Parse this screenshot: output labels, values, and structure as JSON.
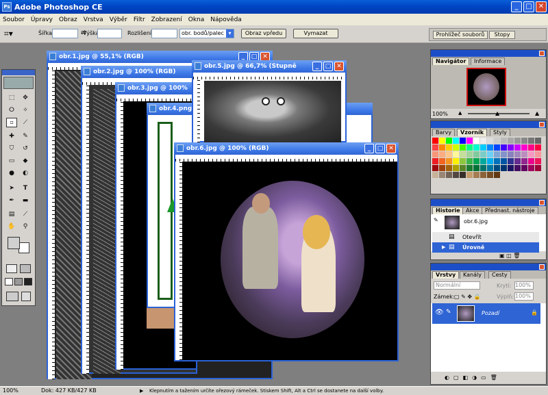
{
  "app": {
    "title": "Adobe Photoshop CE",
    "icon": "photoshop-app-icon",
    "minimize": "_",
    "maximize": "□",
    "close": "✕"
  },
  "menu": [
    "Soubor",
    "Úpravy",
    "Obraz",
    "Vrstva",
    "Výběr",
    "Filtr",
    "Zobrazení",
    "Okna",
    "Nápověda"
  ],
  "options": {
    "width_label": "Šířka:",
    "width_value": "",
    "height_label": "Výška:",
    "height_value": "",
    "resolution_label": "Rozlišení:",
    "resolution_value": "",
    "unit_select": "obr. bodů/palec",
    "front_image_button": "Obraz vpředu",
    "clear_button": "Vymazat",
    "file_browser_tab": "Prohlížeč souborů",
    "brushes_tab": "Stopy"
  },
  "documents": [
    {
      "title": "obr.1.jpg @ 55,1% (RGB)"
    },
    {
      "title": "obr.2.jpg @ 100% (RGB)"
    },
    {
      "title": "obr.3.jpg @ 100%"
    },
    {
      "title": "obr.4.png"
    },
    {
      "title": "obr.5.jpg @ 66,7% (Stupně"
    },
    {
      "title": "obr.6.jpg @ 100% (RGB)"
    }
  ],
  "navigator": {
    "tabs": [
      "Navigátor",
      "Informace"
    ],
    "zoom": "100%"
  },
  "swatches_panel": {
    "tabs": [
      "Barvy",
      "Vzorník",
      "Styly"
    ]
  },
  "swatch_colors": [
    "#ff0000",
    "#ffff00",
    "#00ff00",
    "#00ffff",
    "#0000ff",
    "#ff00ff",
    "#ffffff",
    "#eeeeee",
    "#dddddd",
    "#cccccc",
    "#bbbbbb",
    "#aaaaaa",
    "#999999",
    "#888888",
    "#777777",
    "#666666",
    "#ff4444",
    "#ff8800",
    "#ffcc00",
    "#ccff00",
    "#44ff00",
    "#00ff88",
    "#00ffcc",
    "#00ccff",
    "#0088ff",
    "#0044ff",
    "#4400ff",
    "#8800ff",
    "#cc00ff",
    "#ff00cc",
    "#ff0088",
    "#ff0044",
    "#f7977a",
    "#f9ad81",
    "#fdc68a",
    "#fff79a",
    "#c4df9b",
    "#a2d39c",
    "#82ca9d",
    "#7bcdc8",
    "#6ecff6",
    "#7ea7d8",
    "#8493ca",
    "#8882be",
    "#a187be",
    "#bc8dbf",
    "#f49ac2",
    "#f6989d",
    "#ed1c24",
    "#f26522",
    "#f7941d",
    "#fff200",
    "#8dc73f",
    "#39b54a",
    "#00a651",
    "#00a99d",
    "#00aeef",
    "#0072bc",
    "#0054a6",
    "#2e3192",
    "#662d91",
    "#92278f",
    "#ec008c",
    "#ed145b",
    "#9e0b0f",
    "#a0410d",
    "#a3620a",
    "#aba000",
    "#598527",
    "#1a7b30",
    "#007236",
    "#00746b",
    "#0076a3",
    "#004b80",
    "#003471",
    "#1b1464",
    "#440e62",
    "#630460",
    "#9e005d",
    "#9e0039",
    "#c7b299",
    "#998675",
    "#736357",
    "#534741",
    "#37302a",
    "#c69c6d",
    "#a67c52",
    "#8c6239",
    "#754c24",
    "#603913"
  ],
  "history": {
    "tabs": [
      "Historie",
      "Akce",
      "Přednast. nástroje"
    ],
    "snapshot": "obr.6.jpg",
    "items": [
      "Otevřít",
      "Úrovně"
    ]
  },
  "layers": {
    "tabs": [
      "Vrstvy",
      "Kanály",
      "Cesty"
    ],
    "blend_mode": "Normální",
    "opacity_label": "Krytí:",
    "opacity": "100%",
    "lock_label": "Zámek:",
    "fill_label": "Výplň:",
    "fill": "100%",
    "layer_name": "Pozadí"
  },
  "status": {
    "zoom": "100%",
    "doc": "Dok: 427 KB/427 KB",
    "hint": "Klepnutím a tažením určíte ořezový rámeček. Stiskem Shift, Alt a Ctrl se dostanete na další volby."
  }
}
